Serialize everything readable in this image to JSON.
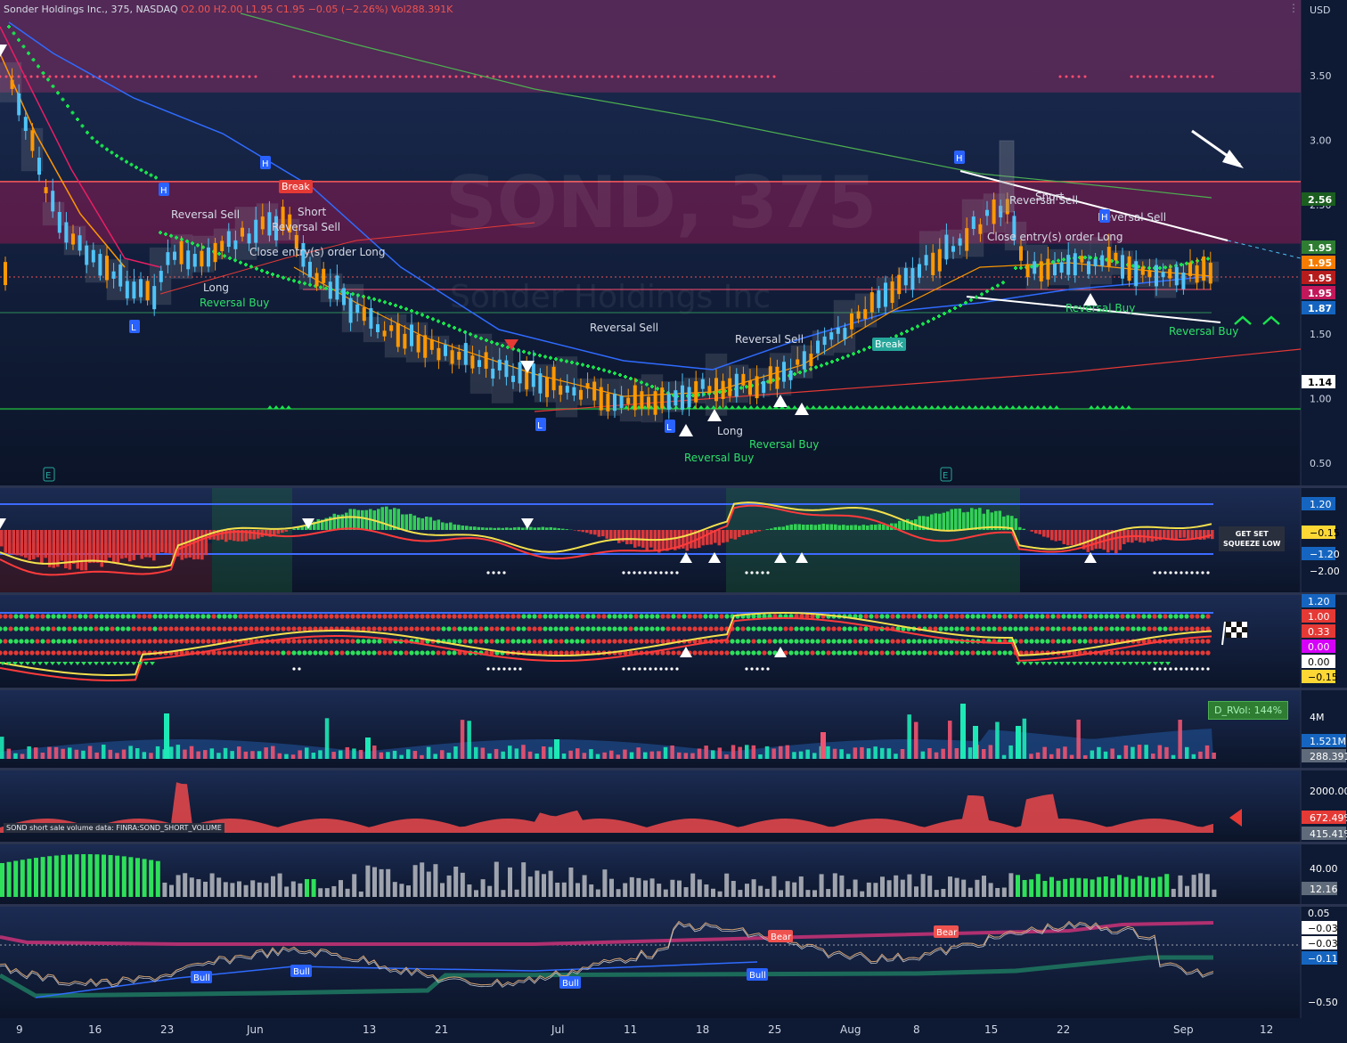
{
  "header": {
    "symbol_line": "Sonder Holdings Inc., 375, NASDAQ",
    "open": "O2.00",
    "high": "H2.00",
    "low": "L1.95",
    "close": "C1.95",
    "change": "−0.05 (−2.26%)",
    "volume": "Vol288.391K",
    "currency": "USD",
    "menu_icon": "more-dots-icon"
  },
  "watermark": {
    "line1": "SOND, 375",
    "line2": "Sonder Holdings Inc"
  },
  "colors": {
    "background": "#0e1a33",
    "up": "#26a69a",
    "down": "#ef5350",
    "candle_up": "#4fc3f7",
    "candle_down": "#ff9800",
    "zone": "#c2185b",
    "psar": "#19e34d",
    "ema_blue": "#2f6bff",
    "ema_green": "#4caf50",
    "support": "#1b8a3a"
  },
  "x_axis": {
    "labels": [
      "9",
      "16",
      "23",
      "Jun",
      "13",
      "21",
      "Jul",
      "11",
      "18",
      "25",
      "Aug",
      "8",
      "15",
      "22",
      "Sep",
      "12"
    ]
  },
  "chart_data": [
    {
      "type": "candlestick",
      "pane": "price",
      "y_ticks": [
        "3.50",
        "3.00",
        "2.50",
        "1.50",
        "1.00",
        "0.50"
      ],
      "ylim": [
        0.5,
        3.5
      ],
      "price_tags": [
        {
          "text": "2.56",
          "bg": "#1b5e20",
          "fg": "#ffffff",
          "value": 2.56
        },
        {
          "text": "1.95",
          "bg": "#2e7d32",
          "fg": "#ffffff",
          "value": 1.95
        },
        {
          "text": "1.95",
          "bg": "#f57c00",
          "fg": "#ffffff",
          "value": 1.95
        },
        {
          "text": "1.95",
          "bg": "#b71c1c",
          "fg": "#ffffff",
          "value": 1.95
        },
        {
          "text": "1.95",
          "bg": "#c2185b",
          "fg": "#ffffff",
          "value": 1.95
        },
        {
          "text": "1.87",
          "bg": "#1565c0",
          "fg": "#ffffff",
          "value": 1.87
        },
        {
          "text": "1.14",
          "bg": "#ffffff",
          "fg": "#000000",
          "value": 1.14
        }
      ],
      "resistance_zone": {
        "low": 2.2,
        "high": 2.68
      },
      "top_zone": {
        "low": 3.37,
        "high": 3.5
      },
      "support_level": 0.92,
      "annotations": [
        {
          "text": "Break",
          "style": "red-box"
        },
        {
          "text": "Short",
          "style": "plain"
        },
        {
          "text": "Reversal Sell",
          "style": "plain"
        },
        {
          "text": "Reversal Sell",
          "style": "plain"
        },
        {
          "text": "Close entry(s) order Long",
          "style": "plain"
        },
        {
          "text": "Long",
          "style": "plain"
        },
        {
          "text": "Reversal Buy",
          "style": "green"
        },
        {
          "text": "Reversal Sell",
          "style": "plain"
        },
        {
          "text": "Reversal Sell",
          "style": "plain"
        },
        {
          "text": "Long",
          "style": "plain"
        },
        {
          "text": "Reversal Buy",
          "style": "green"
        },
        {
          "text": "Reversal Buy",
          "style": "green"
        },
        {
          "text": "Break",
          "style": "green-box"
        },
        {
          "text": "Short",
          "style": "plain"
        },
        {
          "text": "Reversal Sell",
          "style": "plain"
        },
        {
          "text": "Close entry(s) order Long",
          "style": "plain"
        },
        {
          "text": "Reversal Sell",
          "style": "plain"
        },
        {
          "text": "Reversal Buy",
          "style": "green"
        },
        {
          "text": "Reversal Buy",
          "style": "green"
        }
      ],
      "markers": [
        "H",
        "H",
        "H",
        "H",
        "L",
        "L",
        "L",
        "E",
        "E"
      ]
    },
    {
      "type": "histogram",
      "pane": "squeeze",
      "y_ticks": [
        {
          "text": "1.20",
          "bg": "#1565c0"
        },
        {
          "text": "−0.15",
          "bg": "#fdd835"
        },
        {
          "text": "−1.20",
          "bg": "#1565c0"
        },
        {
          "text": "−2.00",
          "bg": ""
        }
      ],
      "tag": {
        "line1": "GET SET",
        "line2": "SQUEEZE LOW"
      }
    },
    {
      "type": "dots",
      "pane": "oscillator",
      "y_ticks": [
        {
          "text": "1.20",
          "bg": "#1565c0"
        },
        {
          "text": "1.00",
          "bg": "#e53935"
        },
        {
          "text": "0.33",
          "bg": "#e53935"
        },
        {
          "text": "0.00",
          "bg": "#d500f9"
        },
        {
          "text": "0.00",
          "bg": "#ffffff"
        },
        {
          "text": "−0.15",
          "bg": "#fdd835"
        }
      ],
      "icon": "checkered-flag-icon"
    },
    {
      "type": "bar",
      "pane": "volume",
      "y_ticks": [
        {
          "text": "4M",
          "bg": ""
        },
        {
          "text": "1.521M",
          "bg": "#1565c0"
        },
        {
          "text": "288.391",
          "bg": "#5f6b7a"
        }
      ],
      "tag": "D_RVol: 144%"
    },
    {
      "type": "area",
      "pane": "short-volume",
      "title": "SOND short sale volume data: FINRA:SOND_SHORT_VOLUME",
      "y_ticks": [
        {
          "text": "2000.00",
          "bg": ""
        },
        {
          "text": "672.49%",
          "bg": "#e53935"
        },
        {
          "text": "415.41%",
          "bg": "#5f6b7a"
        }
      ]
    },
    {
      "type": "bar",
      "pane": "rsi-bars",
      "y_ticks": [
        {
          "text": "40.00",
          "bg": ""
        },
        {
          "text": "12.16",
          "bg": "#5f6b7a"
        }
      ]
    },
    {
      "type": "line",
      "pane": "divergence",
      "y_ticks": [
        {
          "text": "0.05",
          "bg": ""
        },
        {
          "text": "−0.03",
          "bg": "#ffffff"
        },
        {
          "text": "−0.03",
          "bg": "#ffffff"
        },
        {
          "text": "−0.11",
          "bg": "#1565c0"
        },
        {
          "text": "−0.50",
          "bg": ""
        }
      ],
      "labels": [
        {
          "text": "Bull",
          "kind": "bull"
        },
        {
          "text": "Bull",
          "kind": "bull"
        },
        {
          "text": "Bull",
          "kind": "bull"
        },
        {
          "text": "Bull",
          "kind": "bull"
        },
        {
          "text": "Bear",
          "kind": "bear"
        },
        {
          "text": "Bear",
          "kind": "bear"
        }
      ]
    }
  ]
}
